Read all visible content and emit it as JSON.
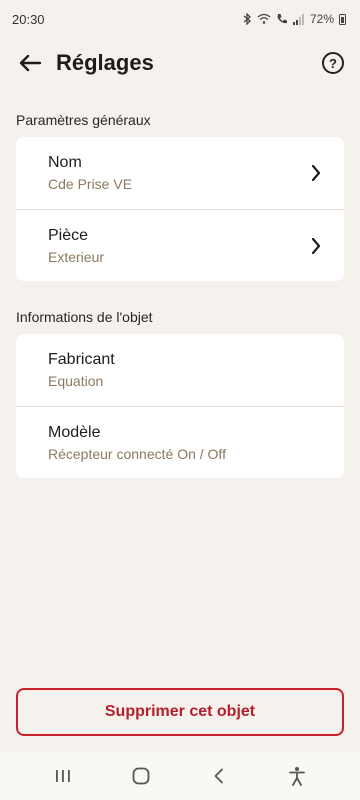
{
  "status_bar": {
    "time": "20:30",
    "battery_text": "72%",
    "icons": [
      "bluetooth-icon",
      "wifi-icon",
      "call-icon",
      "signal-icon",
      "battery-icon"
    ]
  },
  "header": {
    "title": "Réglages",
    "back_icon": "arrow-left-icon",
    "help_icon": "help-circle-icon",
    "help_glyph": "?"
  },
  "sections": [
    {
      "label": "Paramètres généraux",
      "rows": [
        {
          "title": "Nom",
          "value": "Cde Prise VE",
          "has_chevron": true
        },
        {
          "title": "Pièce",
          "value": "Exterieur",
          "has_chevron": true
        }
      ]
    },
    {
      "label": "Informations de l'objet",
      "rows": [
        {
          "title": "Fabricant",
          "value": "Equation",
          "has_chevron": false
        },
        {
          "title": "Modèle",
          "value": "Récepteur connecté On / Off",
          "has_chevron": false
        }
      ]
    }
  ],
  "delete_button": {
    "label": "Supprimer cet objet"
  },
  "nav_bar": {
    "items": [
      "recent-apps-icon",
      "home-icon",
      "back-icon",
      "accessibility-icon"
    ]
  },
  "colors": {
    "background": "#f5f2ee",
    "card": "#ffffff",
    "secondary_text": "#8a7a5e",
    "danger": "#c4232e"
  }
}
